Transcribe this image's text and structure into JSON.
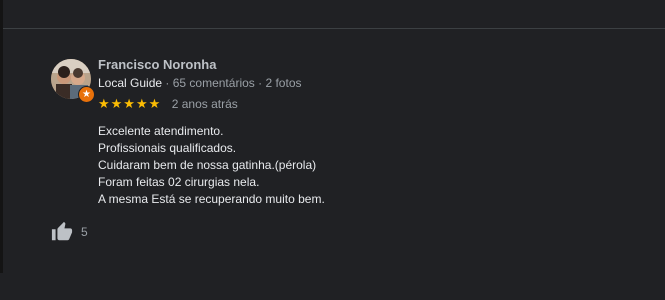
{
  "review": {
    "author": "Francisco Noronha",
    "guide_label": "Local Guide",
    "reviews_count": "65 comentários",
    "photos_count": "2 fotos",
    "separator": "·",
    "stars": "★★★★★",
    "rating": 5,
    "time": "2 anos atrás",
    "text_lines": [
      "Excelente atendimento.",
      "Profissionais qualificados.",
      "Cuidaram bem de nossa gatinha.(pérola)",
      "Foram feitas 02 cirurgias nela.",
      "A mesma Está se recuperando muito bem."
    ],
    "likes": "5",
    "badge_glyph": "★"
  },
  "colors": {
    "background": "#202124",
    "star": "#fbbc04",
    "badge": "#e8710a"
  },
  "icons": {
    "like": "thumbs-up-icon",
    "badge": "local-guide-badge-icon"
  }
}
